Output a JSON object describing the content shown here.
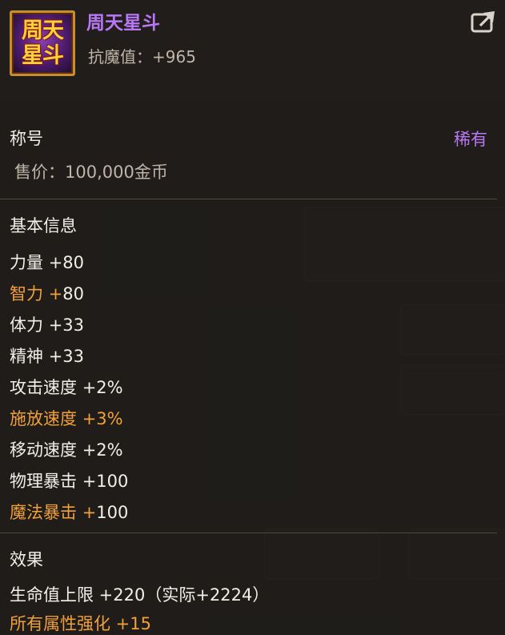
{
  "item": {
    "icon_text_line1": "周天",
    "icon_text_line2": "星斗",
    "name": "周天星斗",
    "resist_label": "抗魔值：",
    "resist_value": "+965",
    "category": "称号",
    "rarity": "稀有",
    "price_label": "售价：",
    "price_value": "100,000金币"
  },
  "basic_info": {
    "title": "基本信息",
    "stats": [
      {
        "label": "力量",
        "value": "+80",
        "highlight": false
      },
      {
        "label": "智力",
        "value": "+80",
        "highlight": true
      },
      {
        "label": "体力",
        "value": "+33",
        "highlight": false
      },
      {
        "label": "精神",
        "value": "+33",
        "highlight": false
      },
      {
        "label": "攻击速度",
        "value": "+2%",
        "highlight": false
      },
      {
        "label": "施放速度",
        "value": "+3%",
        "highlight": true
      },
      {
        "label": "移动速度",
        "value": "+2%",
        "highlight": false
      },
      {
        "label": "物理暴击",
        "value": "+100",
        "highlight": false
      },
      {
        "label": "魔法暴击",
        "value": "+100",
        "highlight": true
      }
    ]
  },
  "effects": {
    "title": "效果",
    "lines": [
      "生命值上限 +220（实际+2224）",
      "所有属性强化 +15"
    ]
  },
  "colors": {
    "name_purple": "#b877f5",
    "highlight_orange": "#f2a039",
    "text_white": "#f2efe9",
    "text_gray": "#bdb6a8"
  },
  "icons": {
    "share": "share-arrow-icon"
  }
}
